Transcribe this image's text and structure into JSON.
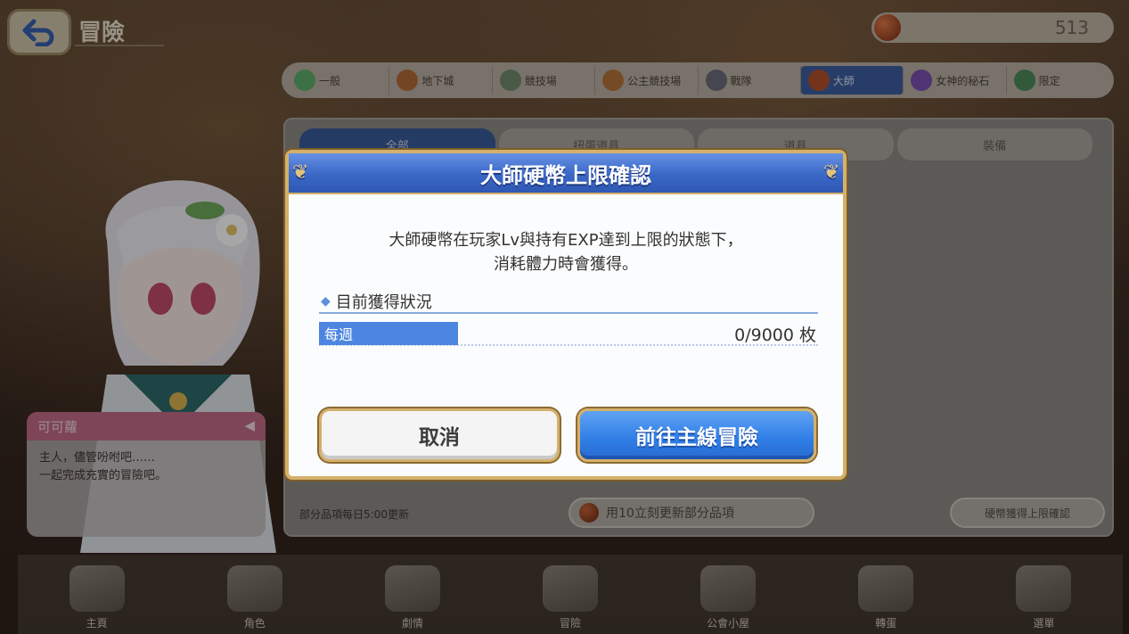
{
  "header": {
    "title": "冒險",
    "stamina_value": "513"
  },
  "category_tabs": [
    {
      "label": "一般",
      "color": "#5fae6a",
      "active": false
    },
    {
      "label": "地下城",
      "color": "#b26a3a",
      "active": false
    },
    {
      "label": "競技場",
      "color": "#6f8a6a",
      "active": false
    },
    {
      "label": "公主競技場",
      "color": "#b4733a",
      "active": false
    },
    {
      "label": "戰隊",
      "color": "#6a6c7a",
      "active": false
    },
    {
      "label": "大師",
      "color": "#b2502c",
      "active": true
    },
    {
      "label": "女神的秘石",
      "color": "#7a4fb0",
      "active": false
    },
    {
      "label": "限定",
      "color": "#4e8a5a",
      "active": false
    }
  ],
  "sub_tabs": [
    {
      "label": "全部",
      "active": true
    },
    {
      "label": "扭蛋道具",
      "active": false
    },
    {
      "label": "道具",
      "active": false
    },
    {
      "label": "裝備",
      "active": false
    }
  ],
  "panel": {
    "footer_text": "部分品項每日5:00更新",
    "refresh_button": "用10立刻更新部分品項",
    "limit_button": "硬幣獲得上限確認"
  },
  "speech": {
    "name": "可可蘿",
    "text": "主人，儘管吩咐吧……\n一起完成充實的冒險吧。"
  },
  "bottom_nav": [
    {
      "label": "主頁"
    },
    {
      "label": "角色"
    },
    {
      "label": "劇情"
    },
    {
      "label": "冒險"
    },
    {
      "label": "公會小屋"
    },
    {
      "label": "轉蛋"
    },
    {
      "label": "選單"
    }
  ],
  "dialog": {
    "title": "大師硬幣上限確認",
    "message_line1": "大師硬幣在玩家Lv與持有EXP達到上限的狀態下，",
    "message_line2": "消耗體力時會獲得。",
    "section_title": "目前獲得狀況",
    "row_label": "每週",
    "row_value": "0/9000 枚",
    "cancel_label": "取消",
    "go_label": "前往主線冒險"
  }
}
